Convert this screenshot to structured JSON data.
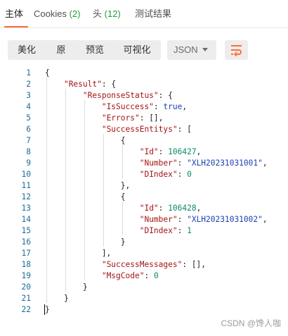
{
  "tabs": [
    {
      "label": "主体",
      "count": ""
    },
    {
      "label": "Cookies",
      "count": "(2)"
    },
    {
      "label": "头",
      "count": "(12)"
    },
    {
      "label": "测试结果",
      "count": ""
    }
  ],
  "toolbar": {
    "view_modes": [
      "美化",
      "原",
      "预览",
      "可视化"
    ],
    "format": "JSON",
    "wrap_icon": "wrap-lines-icon"
  },
  "code_lines": [
    {
      "n": "1",
      "parts": [
        {
          "t": "p",
          "v": "{"
        }
      ]
    },
    {
      "n": "2",
      "parts": [
        {
          "t": "p",
          "v": "    "
        },
        {
          "t": "k",
          "v": "\"Result\""
        },
        {
          "t": "p",
          "v": ": {"
        }
      ]
    },
    {
      "n": "3",
      "parts": [
        {
          "t": "p",
          "v": "        "
        },
        {
          "t": "k",
          "v": "\"ResponseStatus\""
        },
        {
          "t": "p",
          "v": ": {"
        }
      ]
    },
    {
      "n": "4",
      "parts": [
        {
          "t": "p",
          "v": "            "
        },
        {
          "t": "k",
          "v": "\"IsSuccess\""
        },
        {
          "t": "p",
          "v": ": "
        },
        {
          "t": "b",
          "v": "true"
        },
        {
          "t": "p",
          "v": ","
        }
      ]
    },
    {
      "n": "5",
      "parts": [
        {
          "t": "p",
          "v": "            "
        },
        {
          "t": "k",
          "v": "\"Errors\""
        },
        {
          "t": "p",
          "v": ": [],"
        }
      ]
    },
    {
      "n": "6",
      "parts": [
        {
          "t": "p",
          "v": "            "
        },
        {
          "t": "k",
          "v": "\"SuccessEntitys\""
        },
        {
          "t": "p",
          "v": ": ["
        }
      ]
    },
    {
      "n": "7",
      "parts": [
        {
          "t": "p",
          "v": "                {"
        }
      ]
    },
    {
      "n": "8",
      "parts": [
        {
          "t": "p",
          "v": "                    "
        },
        {
          "t": "k",
          "v": "\"Id\""
        },
        {
          "t": "p",
          "v": ": "
        },
        {
          "t": "n",
          "v": "106427"
        },
        {
          "t": "p",
          "v": ","
        }
      ]
    },
    {
      "n": "9",
      "parts": [
        {
          "t": "p",
          "v": "                    "
        },
        {
          "t": "k",
          "v": "\"Number\""
        },
        {
          "t": "p",
          "v": ": "
        },
        {
          "t": "s",
          "v": "\"XLH20231031001\""
        },
        {
          "t": "p",
          "v": ","
        }
      ]
    },
    {
      "n": "10",
      "parts": [
        {
          "t": "p",
          "v": "                    "
        },
        {
          "t": "k",
          "v": "\"DIndex\""
        },
        {
          "t": "p",
          "v": ": "
        },
        {
          "t": "n",
          "v": "0"
        }
      ]
    },
    {
      "n": "11",
      "parts": [
        {
          "t": "p",
          "v": "                },"
        }
      ]
    },
    {
      "n": "12",
      "parts": [
        {
          "t": "p",
          "v": "                {"
        }
      ]
    },
    {
      "n": "13",
      "parts": [
        {
          "t": "p",
          "v": "                    "
        },
        {
          "t": "k",
          "v": "\"Id\""
        },
        {
          "t": "p",
          "v": ": "
        },
        {
          "t": "n",
          "v": "106428"
        },
        {
          "t": "p",
          "v": ","
        }
      ]
    },
    {
      "n": "14",
      "parts": [
        {
          "t": "p",
          "v": "                    "
        },
        {
          "t": "k",
          "v": "\"Number\""
        },
        {
          "t": "p",
          "v": ": "
        },
        {
          "t": "s",
          "v": "\"XLH20231031002\""
        },
        {
          "t": "p",
          "v": ","
        }
      ]
    },
    {
      "n": "15",
      "parts": [
        {
          "t": "p",
          "v": "                    "
        },
        {
          "t": "k",
          "v": "\"DIndex\""
        },
        {
          "t": "p",
          "v": ": "
        },
        {
          "t": "n",
          "v": "1"
        }
      ]
    },
    {
      "n": "16",
      "parts": [
        {
          "t": "p",
          "v": "                }"
        }
      ]
    },
    {
      "n": "17",
      "parts": [
        {
          "t": "p",
          "v": "            ],"
        }
      ]
    },
    {
      "n": "18",
      "parts": [
        {
          "t": "p",
          "v": "            "
        },
        {
          "t": "k",
          "v": "\"SuccessMessages\""
        },
        {
          "t": "p",
          "v": ": [],"
        }
      ]
    },
    {
      "n": "19",
      "parts": [
        {
          "t": "p",
          "v": "            "
        },
        {
          "t": "k",
          "v": "\"MsgCode\""
        },
        {
          "t": "p",
          "v": ": "
        },
        {
          "t": "n",
          "v": "0"
        }
      ]
    },
    {
      "n": "20",
      "parts": [
        {
          "t": "p",
          "v": "        }"
        }
      ]
    },
    {
      "n": "21",
      "parts": [
        {
          "t": "p",
          "v": "    }"
        }
      ]
    },
    {
      "n": "22",
      "parts": [
        {
          "t": "p",
          "v": "}"
        }
      ]
    }
  ],
  "watermark": "CSDN @馋人咖",
  "colors": {
    "active_tab_underline": "#ff6c37",
    "count": "#1e9e3a",
    "key": "#a31515",
    "string": "#1f3fb0",
    "number": "#0d8a6a",
    "line_number": "#1f6b97"
  }
}
